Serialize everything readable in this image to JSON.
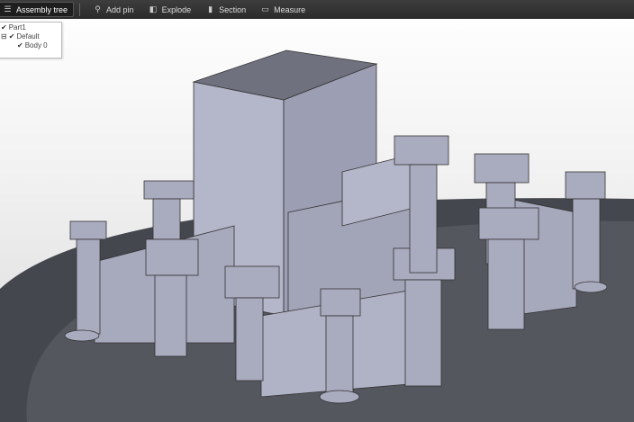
{
  "toolbar": {
    "assembly_tree": "Assembly tree",
    "add_pin": "Add pin",
    "explode": "Explode",
    "section": "Section",
    "measure": "Measure"
  },
  "tree": {
    "items": [
      {
        "label": "Part1"
      },
      {
        "label": "Default"
      },
      {
        "label": "Body 0"
      }
    ]
  },
  "colors": {
    "toolbar": "#333333",
    "model": "#aaacc2",
    "base": "#50525a"
  }
}
